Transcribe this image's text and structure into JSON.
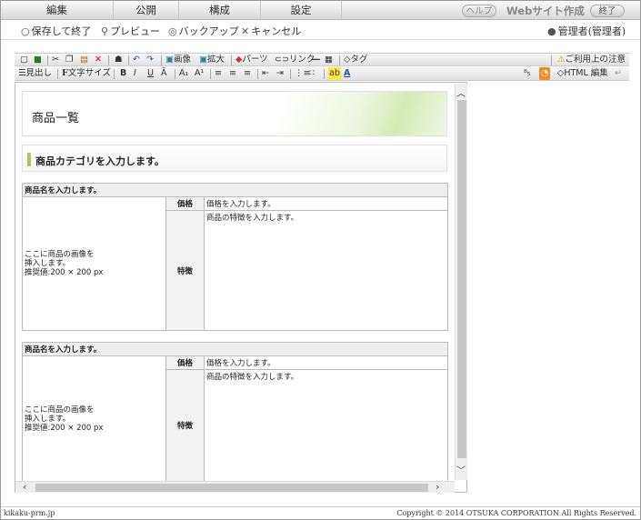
{
  "top_menu": {
    "tabs": [
      "編集",
      "公開",
      "構成",
      "設定"
    ],
    "help_label": "ヘルプ",
    "app_title": "Webサイト作成",
    "exit_label": "終了"
  },
  "actions": {
    "save_exit": "保存して終了",
    "preview": "プレビュー",
    "backup": "バックアップ",
    "cancel": "キャンセル",
    "user": "管理者(管理者)"
  },
  "toolbar": {
    "image_label": "画像",
    "enlarge_label": "拡大",
    "parts_label": "パーツ",
    "link_label": "リンク",
    "tag_label": "タグ",
    "notice_label": "ご利用上の注意",
    "heading_label": "見出し",
    "textsize_label": "文字サイズ",
    "html_edit_label": "HTML 編集"
  },
  "content": {
    "page_title": "商品一覧",
    "category_heading": "商品カテゴリを入力します。",
    "products": [
      {
        "name": "商品名を入力します。",
        "image_lines": [
          "ここに商品の画像を",
          "挿入します。",
          "推奨値:200 × 200 px"
        ],
        "price_label": "価格",
        "price_value": "価格を入力します。",
        "feature_label": "特徴",
        "feature_value": "商品の特徴を入力します。"
      },
      {
        "name": "商品名を入力します。",
        "image_lines": [
          "ここに商品の画像を",
          "挿入します。",
          "推奨値:200 × 200 px"
        ],
        "price_label": "価格",
        "price_value": "価格を入力します。",
        "feature_label": "特徴",
        "feature_value": "商品の特徴を入力します。"
      }
    ]
  },
  "footer": {
    "domain": "kikaku-prm.jp",
    "copyright": "Copyright © 2014 OTSUKA CORPORATION All Rights Reserved."
  }
}
